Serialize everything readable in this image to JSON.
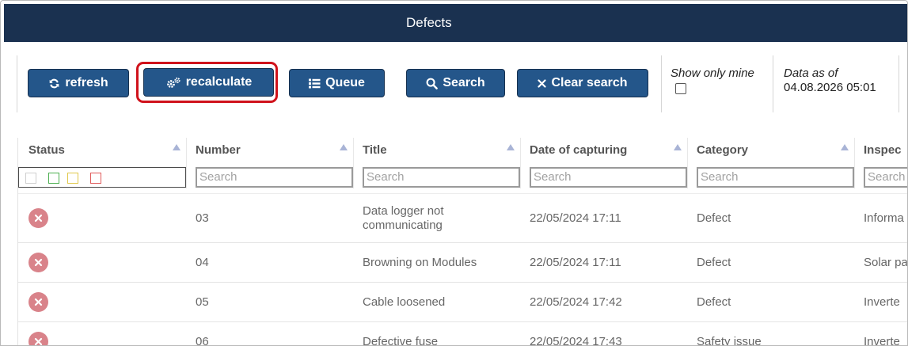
{
  "header": {
    "title": "Defects"
  },
  "toolbar": {
    "refresh_label": "refresh",
    "recalculate_label": "recalculate",
    "queue_label": "Queue",
    "search_label": "Search",
    "clear_search_label": "Clear search",
    "show_only_mine_label": "Show only mine",
    "show_only_mine_checked": false,
    "data_as_of_label": "Data as of",
    "data_as_of_value": "04.08.2026 05:01"
  },
  "grid": {
    "columns": [
      {
        "key": "status",
        "label": "Status"
      },
      {
        "key": "number",
        "label": "Number"
      },
      {
        "key": "title",
        "label": "Title"
      },
      {
        "key": "date",
        "label": "Date of capturing"
      },
      {
        "key": "category",
        "label": "Category"
      },
      {
        "key": "inspection",
        "label": "Inspec"
      }
    ],
    "search_placeholder": "Search",
    "status_filter_colors": [
      "#cfcfcf",
      "#4caf50",
      "#e0c84a",
      "#e05a5a"
    ],
    "rows": [
      {
        "status": "error",
        "number": "03",
        "title_line1": "Data logger not",
        "title_line2": "communicating",
        "date": "22/05/2024 17:11",
        "category": "Defect",
        "inspection": "Informa"
      },
      {
        "status": "error",
        "number": "04",
        "title_line1": "Browning on Modules",
        "title_line2": "",
        "date": "22/05/2024 17:11",
        "category": "Defect",
        "inspection": "Solar pa"
      },
      {
        "status": "error",
        "number": "05",
        "title_line1": "Cable loosened",
        "title_line2": "",
        "date": "22/05/2024 17:42",
        "category": "Defect",
        "inspection": "Inverte"
      },
      {
        "status": "error",
        "number": "06",
        "title_line1": "Defective fuse",
        "title_line2": "",
        "date": "22/05/2024 17:43",
        "category": "Safety issue",
        "inspection": "Inverte"
      }
    ]
  },
  "colors": {
    "header_bg": "#1a3150",
    "button_bg": "#24568a",
    "focus_ring": "#d0121b",
    "error_badge": "#d9838a"
  }
}
